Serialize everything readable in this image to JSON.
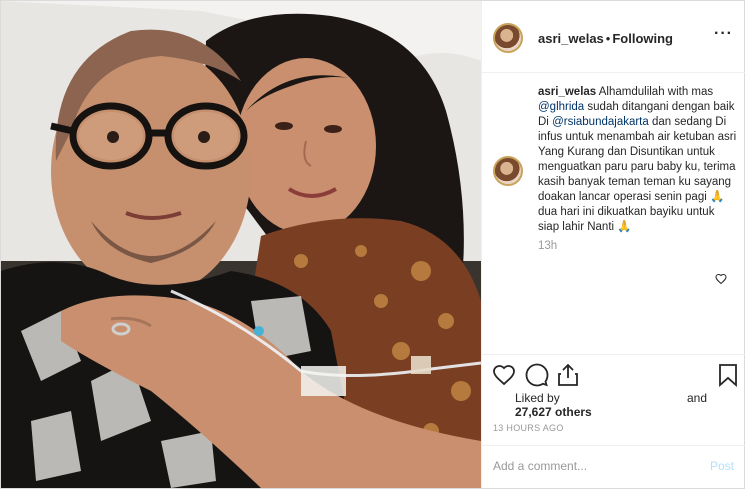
{
  "post": {
    "username": "asri_welas",
    "separator": "•",
    "follow_state": "Following",
    "more_icon": "more-options-icon"
  },
  "caption": {
    "username": "asri_welas",
    "text_1": "Alhamdulilah with mas",
    "mention_1": "@glhrida",
    "text_2": "sudah ditangani dengan baik Di",
    "mention_2": "@rsiabundajakarta",
    "text_3": "dan sedang Di infus untuk menambah air ketuban asri Yang Kurang dan Disuntikan untuk menguatkan paru paru baby ku, terima kasih banyak teman teman ku sayang doakan lancar operasi senin pagi",
    "emoji_1": "🙏",
    "text_4": "dua hari ini dikuatkan bayiku untuk siap lahir Nanti",
    "emoji_2": "🙏",
    "relative_time": "13h"
  },
  "actions": {
    "like_icon": "heart-icon",
    "comment_icon": "comment-icon",
    "share_icon": "share-icon",
    "save_icon": "bookmark-icon"
  },
  "likes": {
    "line1": "Liked by",
    "and_text": "and",
    "count_text": "27,627 others"
  },
  "timestamp": "13 HOURS AGO",
  "comment_box": {
    "placeholder": "Add a comment...",
    "post_label": "Post"
  },
  "colors": {
    "mention": "#003569",
    "border": "#dbdbdb",
    "post_disabled": "#b2dffc",
    "muted": "#999999"
  }
}
